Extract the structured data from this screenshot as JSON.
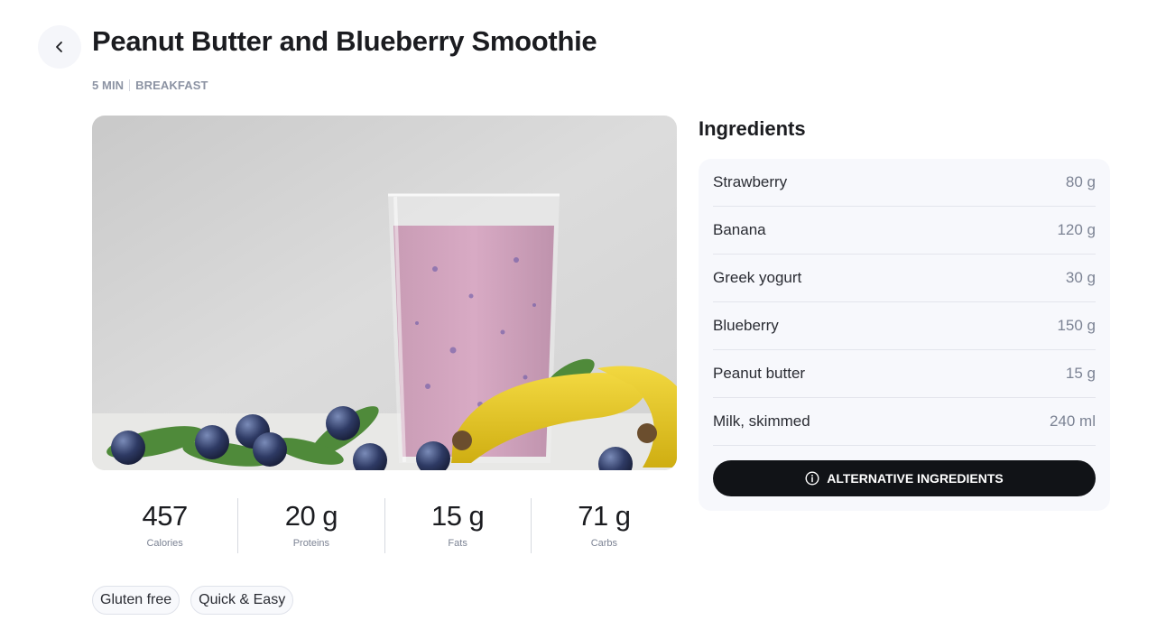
{
  "header": {
    "title": "Peanut Butter and Blueberry Smoothie",
    "duration": "5 MIN",
    "category": "BREAKFAST",
    "back_icon": "chevron-left-icon"
  },
  "image": {
    "subject": "smoothie-photo"
  },
  "macros": [
    {
      "value": "457",
      "label": "Calories"
    },
    {
      "value": "20 g",
      "label": "Proteins"
    },
    {
      "value": "15 g",
      "label": "Fats"
    },
    {
      "value": "71 g",
      "label": "Carbs"
    }
  ],
  "tags": [
    "Gluten free",
    "Quick & Easy"
  ],
  "ingredients": {
    "heading": "Ingredients",
    "items": [
      {
        "name": "Strawberry",
        "qty": "80 g"
      },
      {
        "name": "Banana",
        "qty": "120 g"
      },
      {
        "name": "Greek yogurt",
        "qty": "30 g"
      },
      {
        "name": "Blueberry",
        "qty": "150 g"
      },
      {
        "name": "Peanut butter",
        "qty": "15 g"
      },
      {
        "name": "Milk, skimmed",
        "qty": "240 ml"
      }
    ],
    "alt_button_label": "ALTERNATIVE INGREDIENTS",
    "alt_button_icon": "info-icon"
  },
  "colors": {
    "button_dark": "#111317",
    "card_bg": "#f7f8fc",
    "muted_text": "#7c8394"
  }
}
